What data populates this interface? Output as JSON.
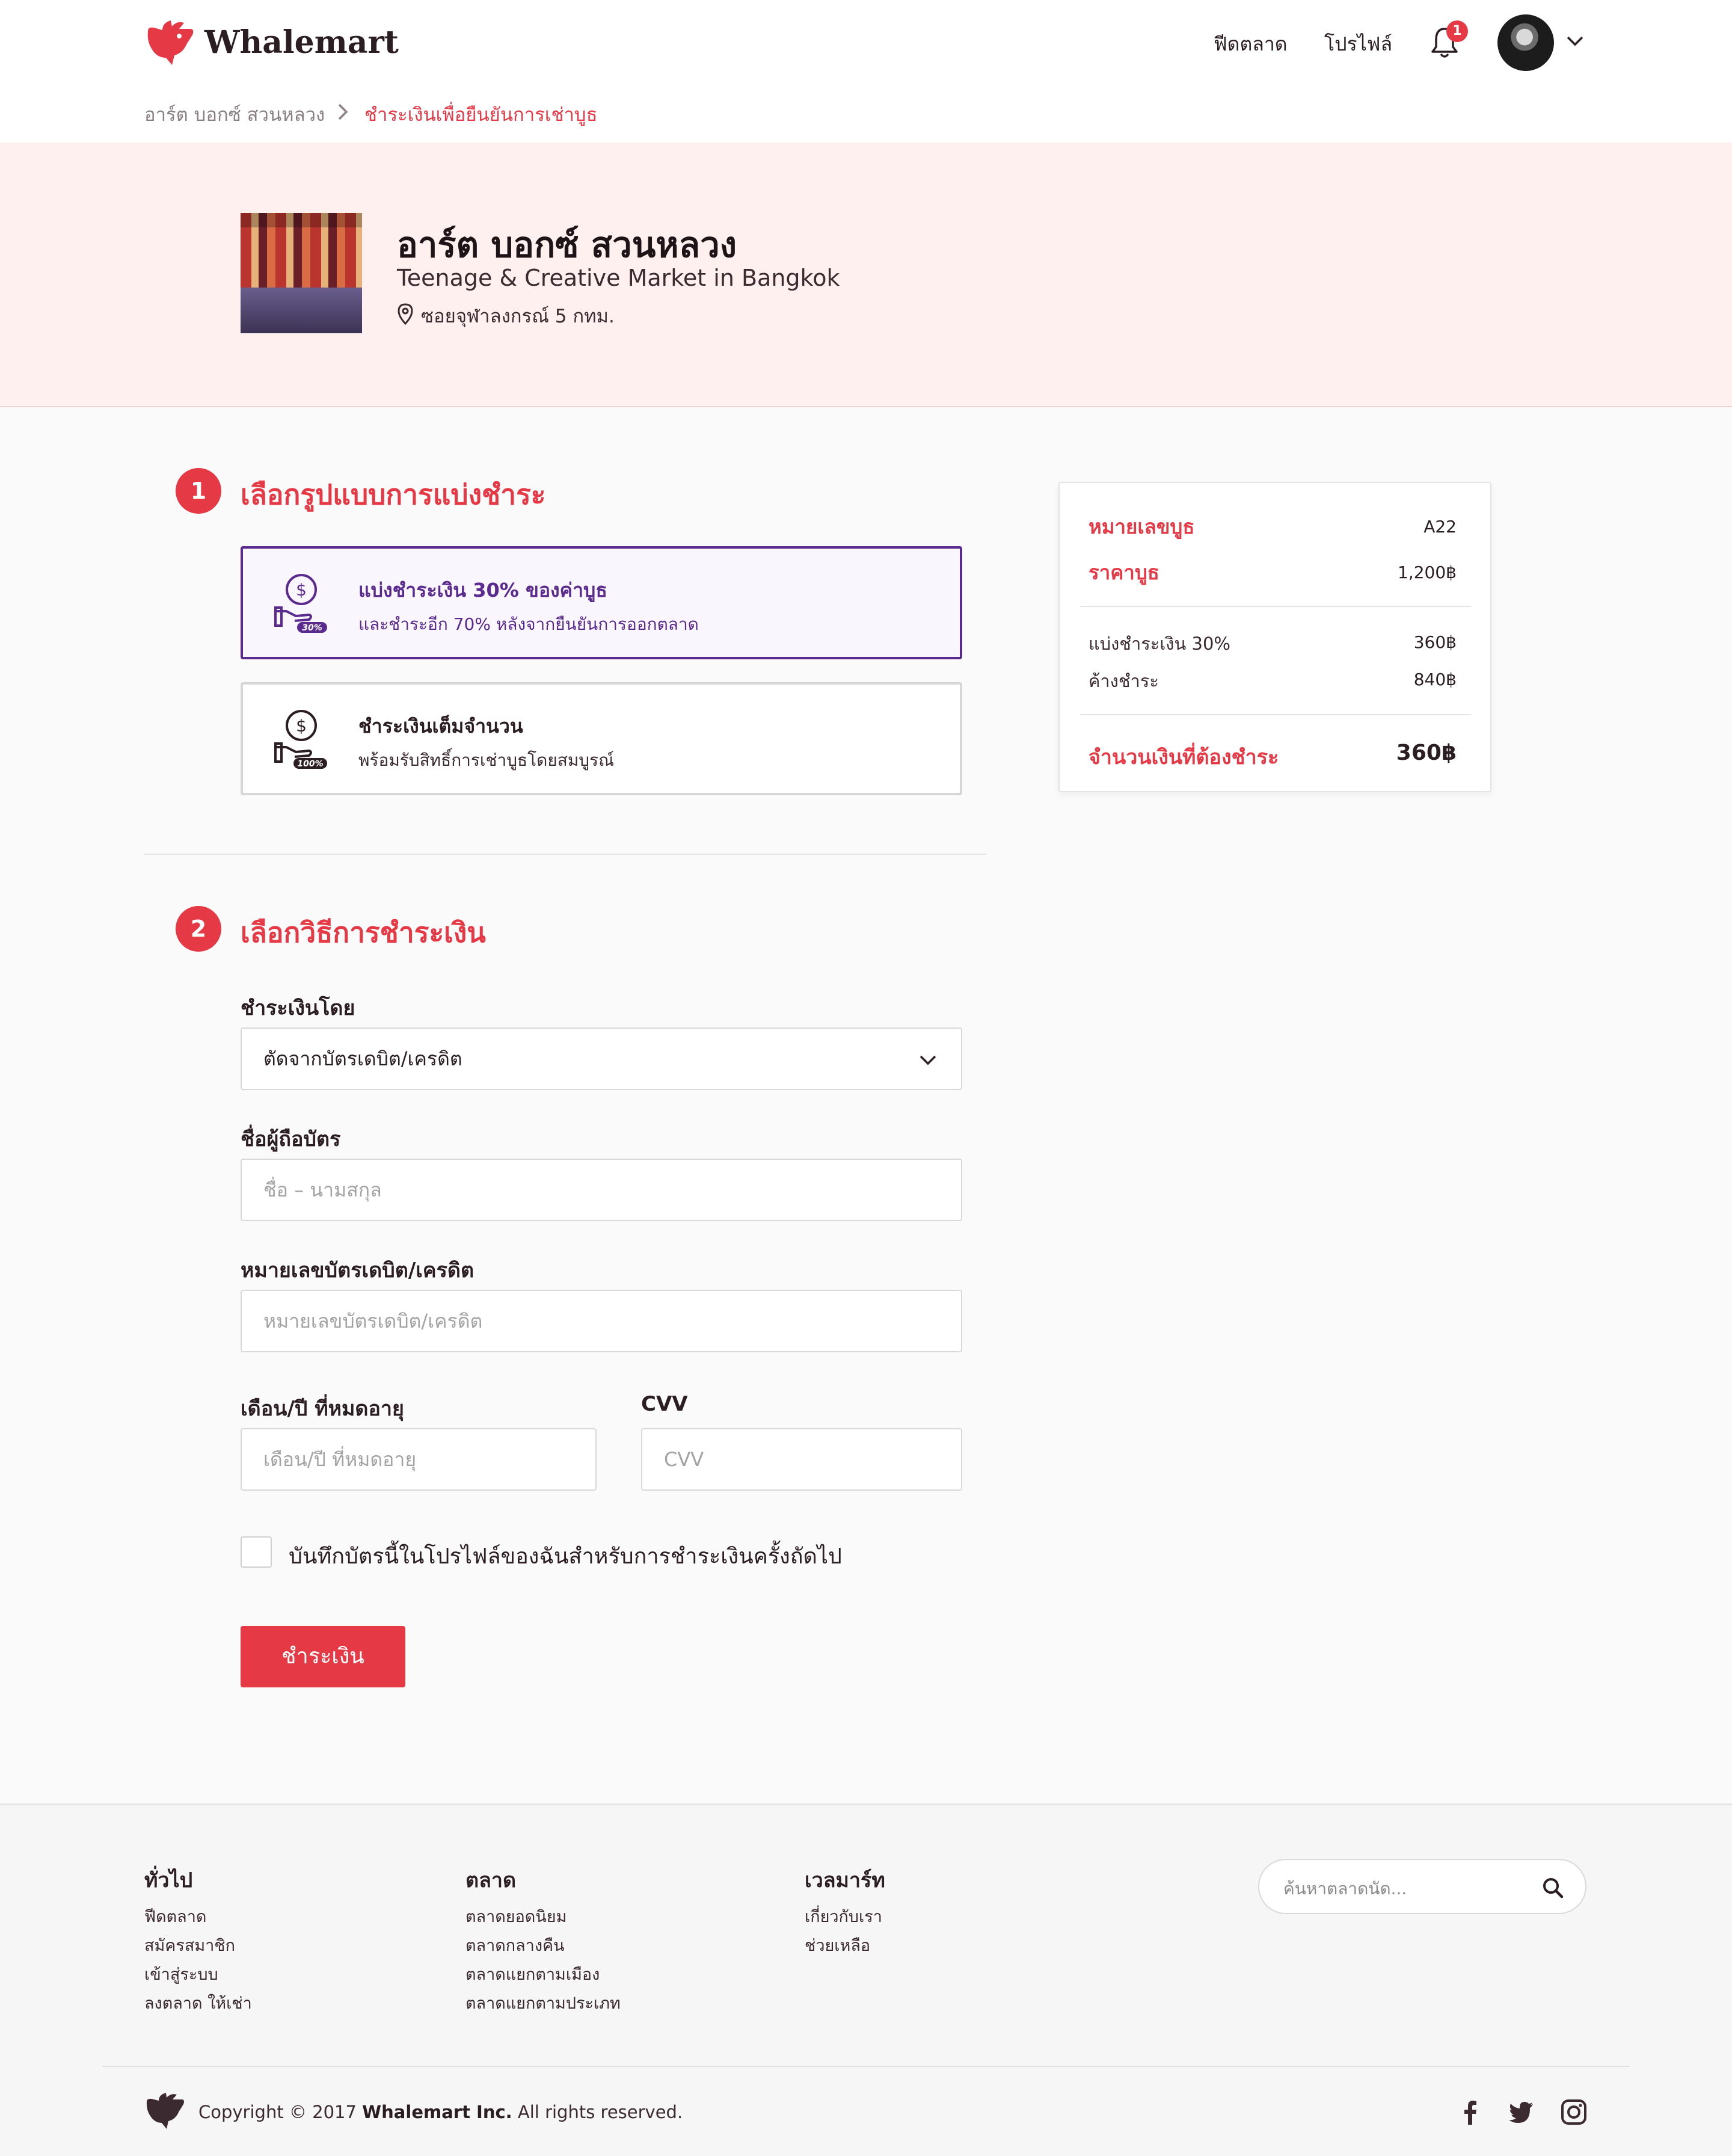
{
  "header": {
    "brand": "Whalemart",
    "nav": {
      "market_label": "ฟีดตลาด",
      "profile_label": "โปรไฟล์"
    },
    "notifications_count": "1",
    "breadcrumb": {
      "parent": "อาร์ต บอกซ์ สวนหลวง",
      "current": "ชำระเงินเพื่อยืนยันการเช่าบูธ"
    }
  },
  "market": {
    "name": "อาร์ต บอกซ์ สวนหลวง",
    "subtitle": "Teenage & Creative Market in Bangkok",
    "location": "ซอยจุฬาลงกรณ์ 5 กทม."
  },
  "step1": {
    "number": "1",
    "title": "เลือกรูปแบบการแบ่งชำระ",
    "options": [
      {
        "title": "แบ่งชำระเงิน 30% ของค่าบูธ",
        "subtitle": "และชำระอีก 70% หลังจากยืนยันการออกตลาด",
        "badge": "30%",
        "selected": true
      },
      {
        "title": "ชำระเงินเต็มจำนวน",
        "subtitle": "พร้อมรับสิทธิ์การเช่าบูธโดยสมบูรณ์",
        "badge": "100%",
        "selected": false
      }
    ]
  },
  "step2": {
    "number": "2",
    "title": "เลือกวิธีการชำระเงิน",
    "method_label": "ชำระเงินโดย",
    "method_value": "ตัดจากบัตรเดบิต/เครดิต",
    "holder_label": "ชื่อผู้ถือบัตร",
    "holder_placeholder": "ชื่อ – นามสกุล",
    "card_label": "หมายเลขบัตรเดบิต/เครดิต",
    "card_placeholder": "หมายเลขบัตรเดบิต/เครดิต",
    "expiry_label": "เดือน/ปี ที่หมดอายุ",
    "expiry_placeholder": "เดือน/ปี ที่หมดอายุ",
    "cvv_label": "CVV",
    "cvv_placeholder": "CVV",
    "save_card_label": "บันทึกบัตรนี้ในโปรไฟล์ของฉันสำหรับการชำระเงินครั้งถัดไป",
    "pay_button": "ชำระเงิน"
  },
  "summary": {
    "booth_no_label": "หมายเลขบูธ",
    "booth_no_value": "A22",
    "price_label": "ราคาบูธ",
    "price_value": "1,200฿",
    "partial_label": "แบ่งชำระเงิน 30%",
    "partial_value": "360฿",
    "remaining_label": "ค้างชำระ",
    "remaining_value": "840฿",
    "total_label": "จำนวนเงินที่ต้องชำระ",
    "total_value": "360฿"
  },
  "footer": {
    "col1": {
      "title": "ทั่วไป",
      "links": [
        "ฟีดตลาด",
        "สมัครสมาชิก",
        "เข้าสู่ระบบ",
        "ลงตลาด ให้เช่า"
      ]
    },
    "col2": {
      "title": "ตลาด",
      "links": [
        "ตลาดยอดนิยม",
        "ตลาดกลางคืน",
        "ตลาดแยกตามเมือง",
        "ตลาดแยกตามประเภท"
      ]
    },
    "col3": {
      "title": "เวลมาร์ท",
      "links": [
        "เกี่ยวกับเรา",
        "ช่วยเหลือ"
      ]
    },
    "search_placeholder": "ค้นหาตลาดนัด...",
    "copyright_prefix": "Copyright © 2017",
    "copyright_company": "Whalemart Inc.",
    "copyright_suffix": "All rights reserved."
  },
  "colors": {
    "accent": "#e63946",
    "selected": "#5a2a8f",
    "text": "#2b1e22"
  }
}
